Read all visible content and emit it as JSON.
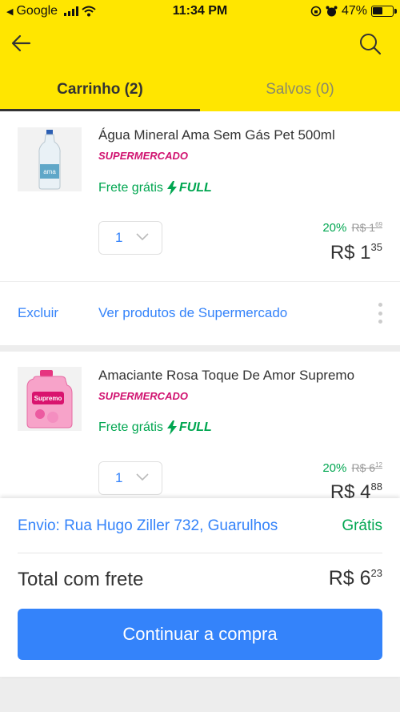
{
  "status_bar": {
    "carrier": "Google",
    "time": "11:34 PM",
    "battery": "47%"
  },
  "header": {
    "accent_color": "#ffe600",
    "back_icon": "arrow-left-icon",
    "search_icon": "search-icon"
  },
  "tabs": [
    {
      "label": "Carrinho (2)",
      "active": true
    },
    {
      "label": "Salvos (0)",
      "active": false
    }
  ],
  "items": [
    {
      "title": "Água Mineral Ama Sem Gás Pet 500ml",
      "store": "SUPERMERCADO",
      "shipping": "Frete grátis",
      "badge": "FULL",
      "quantity": "1",
      "discount": "20%",
      "old_price_int": "R$ 1",
      "old_price_cents": "69",
      "price_int": "R$ 1",
      "price_cents": "35",
      "remove_label": "Excluir",
      "see_more_label": "Ver produtos de Supermercado"
    },
    {
      "title": "Amaciante  Rosa Toque De Amor Supremo",
      "store": "SUPERMERCADO",
      "shipping": "Frete grátis",
      "badge": "FULL",
      "quantity": "1",
      "discount": "20%",
      "old_price_int": "R$ 6",
      "old_price_cents": "12",
      "price_int": "R$ 4",
      "price_cents": "88"
    }
  ],
  "footer": {
    "shipping_address": "Envio: Rua Hugo Ziller 732, Guarulhos",
    "shipping_cost": "Grátis",
    "total_label": "Total com frete",
    "total_int": "R$ 6",
    "total_cents": "23",
    "cta_label": "Continuar a compra"
  },
  "colors": {
    "link_blue": "#3483fa",
    "green": "#00a650",
    "store_pink": "#d0116f"
  }
}
